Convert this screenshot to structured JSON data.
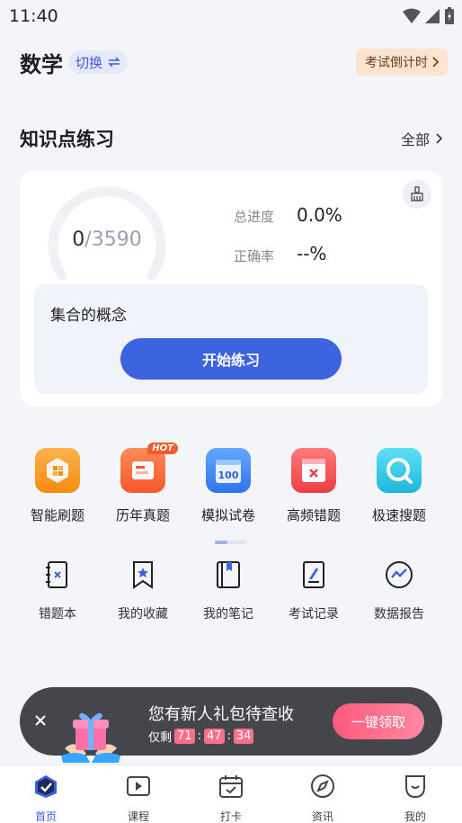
{
  "status_bar": {
    "time": "11:40"
  },
  "header": {
    "subject": "数学",
    "switch_label": "切换",
    "countdown_label": "考试倒计时"
  },
  "knowledge": {
    "section_title": "知识点练习",
    "all_label": "全部",
    "progress_done": "0",
    "progress_total": "/3590",
    "total_progress_label": "总进度",
    "total_progress_value": "0.0%",
    "accuracy_label": "正确率",
    "accuracy_value": "--%",
    "topic": "集合的概念",
    "start_label": "开始练习"
  },
  "grid1": [
    {
      "label": "智能刷题",
      "icon": "smart-practice-icon"
    },
    {
      "label": "历年真题",
      "icon": "past-exams-icon",
      "badge": "HOT"
    },
    {
      "label": "模拟试卷",
      "icon": "mock-paper-icon",
      "icon_text": "100"
    },
    {
      "label": "高频错题",
      "icon": "frequent-errors-icon"
    },
    {
      "label": "极速搜题",
      "icon": "search-question-icon"
    }
  ],
  "grid2": [
    {
      "label": "错题本",
      "icon": "error-book-icon"
    },
    {
      "label": "我的收藏",
      "icon": "bookmark-icon"
    },
    {
      "label": "我的笔记",
      "icon": "notebook-icon"
    },
    {
      "label": "考试记录",
      "icon": "exam-record-icon"
    },
    {
      "label": "数据报告",
      "icon": "data-report-icon"
    }
  ],
  "promo": {
    "title": "您有新人礼包待查收",
    "remain_label": "仅剩",
    "hours": "71",
    "minutes": "47",
    "seconds": "34",
    "sep": ":",
    "button": "一键领取"
  },
  "nav": [
    {
      "label": "首页",
      "icon": "home-icon",
      "active": true
    },
    {
      "label": "课程",
      "icon": "course-icon"
    },
    {
      "label": "打卡",
      "icon": "checkin-icon"
    },
    {
      "label": "资讯",
      "icon": "compass-icon"
    },
    {
      "label": "我的",
      "icon": "profile-icon"
    }
  ],
  "colors": {
    "accent": "#3c63e0",
    "promo_bg": "#45464b",
    "hot": "#f25d2a",
    "timer": "#ff6f8a"
  }
}
